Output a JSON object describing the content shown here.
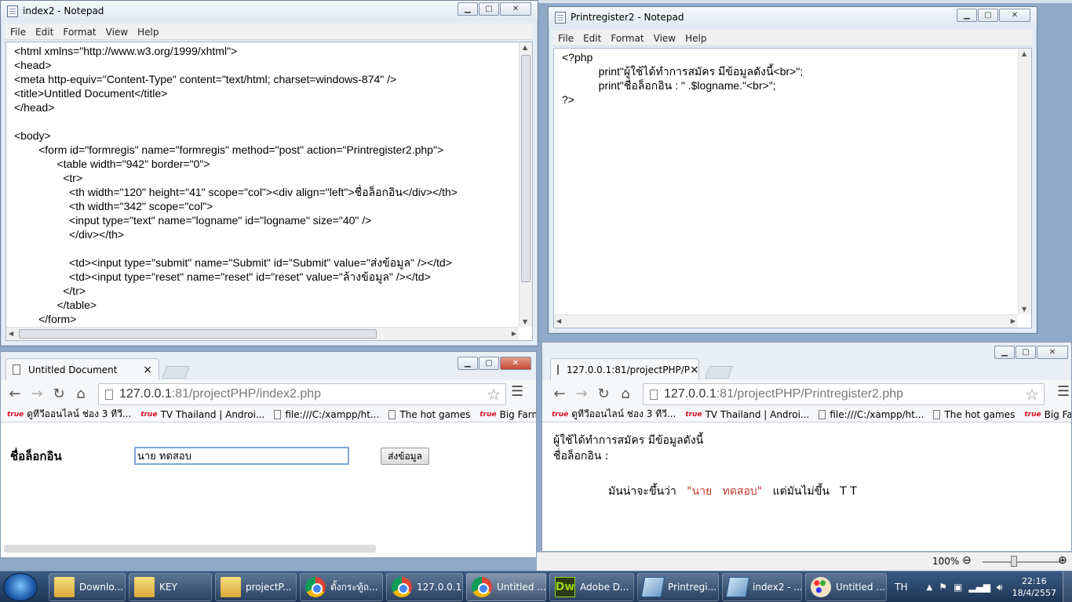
{
  "notepad_left": {
    "title": "index2 - Notepad",
    "menu": [
      "File",
      "Edit",
      "Format",
      "View",
      "Help"
    ],
    "lines": [
      "<html xmlns=\"http://www.w3.org/1999/xhtml\">",
      "<head>",
      "<meta http-equiv=\"Content-Type\" content=\"text/html; charset=windows-874\" />",
      "<title>Untitled Document</title>",
      "</head>",
      "",
      "<body>",
      "        <form id=\"formregis\" name=\"formregis\" method=\"post\" action=\"Printregister2.php\">",
      "              <table width=\"942\" border=\"0\">",
      "                <tr>",
      "                  <th width=\"120\" height=\"41\" scope=\"col\"><div align=\"left\">ชื่อล็อกอิน</div></th>",
      "                  <th width=\"342\" scope=\"col\">",
      "                  <input type=\"text\" name=\"logname\" id=\"logname\" size=\"40\" />",
      "                  </div></th>",
      "",
      "                  <td><input type=\"submit\" name=\"Submit\" id=\"Submit\" value=\"ส่งข้อมูล\" /></td>",
      "                  <td><input type=\"reset\" name=\"reset\" id=\"reset\" value=\"ล้างข้อมูล\" /></td>",
      "                </tr>",
      "              </table>",
      "        </form>"
    ]
  },
  "notepad_right": {
    "title": "Printregister2 - Notepad",
    "menu": [
      "File",
      "Edit",
      "Format",
      "View",
      "Help"
    ],
    "lines": [
      "<?php",
      "            print\"ผู้ใช้ได้ทำการสมัคร มีข้อมูลดังนี้<br>\";",
      "            print\"ชื่อล็อกอิน : \" .$logname.\"<br>\";",
      "?>"
    ]
  },
  "chrome_left": {
    "tab_title": "Untitled Document",
    "url_host": "127.0.0.1",
    "url_path": ":81/projectPHP/index2.php",
    "bookmarks": [
      "ดูทีวีออนไลน์ ช่อง 3 ทีวี...",
      "TV Thailand | Androi...",
      "file:///C:/xampp/ht...",
      "The hot games",
      "Big Farm"
    ],
    "form_label": "ชื่อล็อกอิน",
    "input_value": "นาย ทดสอบ",
    "submit_label": "ส่งข้อมูล"
  },
  "chrome_right": {
    "tab_title": "127.0.0.1:81/projectPHP/P",
    "url_host": "127.0.0.1",
    "url_path": ":81/projectPHP/Printregister2.php",
    "bookmarks": [
      "ดูทีวีออนไลน์ ช่อง 3 ทีวี...",
      "TV Thailand | Androi...",
      "file:///C:/xampp/ht...",
      "The hot games",
      "Big Farm"
    ],
    "line1": "ผู้ใช้ได้ทำการสมัคร มีข้อมูลดังนี้",
    "line2": "ชื่อล็อกอิน :",
    "note_a": "มันน่าจะขึ้นว่า",
    "note_b": "\"นาย   ทดสอบ\"",
    "note_c": "แต่มันไม่ขึ้น   T T",
    "zoom": "100%"
  },
  "taskbar": {
    "items": [
      "Downlo...",
      "KEY",
      "projectP...",
      "ตั้งกระทู้ถ...",
      "127.0.0.1...",
      "Untitled ...",
      "Adobe D...",
      "Printregi...",
      "index2 - ...",
      "Untitled ..."
    ],
    "lang": "TH",
    "time": "22:16",
    "date": "18/4/2557"
  },
  "colors": {
    "accent_red": "#c0392b",
    "chrome_tab": "#f6f7f9"
  }
}
